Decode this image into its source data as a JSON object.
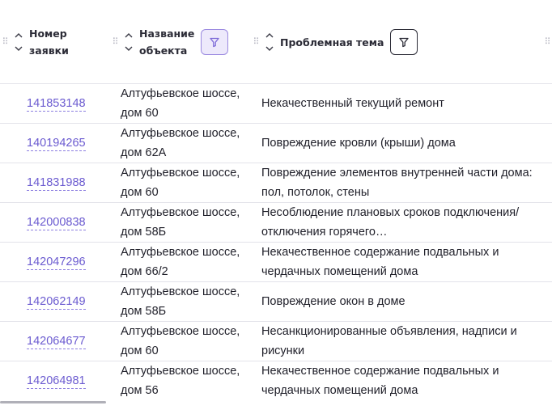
{
  "columns": {
    "number": {
      "line1": "Номер",
      "line2": "заявки"
    },
    "object": {
      "line1": "Название",
      "line2": "объекта",
      "filter_active": true
    },
    "topic": {
      "label": "Проблемная тема",
      "filter_active": false
    }
  },
  "rows": [
    {
      "number": "141853148",
      "object": "Алтуфьевское шоссе, дом 60",
      "topic": "Некачественный текущий ремонт"
    },
    {
      "number": "140194265",
      "object": "Алтуфьевское шоссе, дом 62А",
      "topic": "Повреждение кровли (крыши) дома"
    },
    {
      "number": "141831988",
      "object": "Алтуфьевское шоссе, дом 60",
      "topic": "Повреждение элементов внутренней части дома: пол, потолок, стены"
    },
    {
      "number": "142000838",
      "object": "Алтуфьевское шоссе, дом 58Б",
      "topic": "Несоблюдение плановых сроков подключения/отключения горячего…"
    },
    {
      "number": "142047296",
      "object": "Алтуфьевское шоссе, дом 66/2",
      "topic": "Некачественное содержание подвальных и чердачных помещений дома"
    },
    {
      "number": "142062149",
      "object": "Алтуфьевское шоссе, дом 58Б",
      "topic": "Повреждение окон в доме"
    },
    {
      "number": "142064677",
      "object": "Алтуфьевское шоссе, дом 60",
      "topic": "Несанкционированные объявления, надписи и рисунки"
    },
    {
      "number": "142064981",
      "object": "Алтуфьевское шоссе, дом 56",
      "topic": "Некачественное содержание подвальных и чердачных помещений дома"
    }
  ],
  "colors": {
    "link": "#6b5bd0",
    "filter_active_bg": "#ede9fb",
    "filter_active_border": "#9b8ae0"
  },
  "icons": {
    "sort": "sort-arrows-icon",
    "drag": "drag-handle-icon",
    "filter": "filter-icon"
  }
}
